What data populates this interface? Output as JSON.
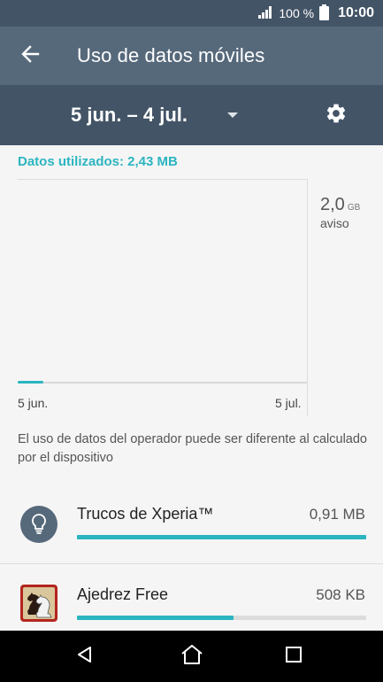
{
  "status_bar": {
    "battery_text": "100 %",
    "time": "10:00",
    "icons": [
      "signal-icon",
      "battery-icon"
    ]
  },
  "toolbar": {
    "title": "Uso de datos móviles",
    "back_icon": "arrow-left-icon"
  },
  "period": {
    "label": "5 jun. – 4 jul.",
    "dropdown_icon": "triangle-down-icon",
    "settings_icon": "gear-icon"
  },
  "usage": {
    "data_used_text": "Datos utilizados: 2,43 MB"
  },
  "chart": {
    "warning_value": "2,0",
    "warning_unit": "GB",
    "warning_label": "aviso",
    "axis_start": "5 jun.",
    "axis_end": "5 jul.",
    "accent_color": "#2bb5c0"
  },
  "disclaimer": "El uso de datos del operador puede ser diferente al calculado por el dispositivo",
  "apps": [
    {
      "name": "Trucos de Xperia™",
      "size": "0,91 MB",
      "usage_fraction": 1.0,
      "icon": "lightbulb-icon"
    },
    {
      "name": "Ajedrez Free",
      "size": "508 KB",
      "usage_fraction": 0.54,
      "icon": "chess-knight-icon"
    }
  ],
  "nav": {
    "back_icon": "nav-back-icon",
    "home_icon": "nav-home-icon",
    "recents_icon": "nav-recents-icon"
  },
  "colors": {
    "status_bar": "#435466",
    "toolbar": "#56697b",
    "accent": "#2bb5c0"
  }
}
